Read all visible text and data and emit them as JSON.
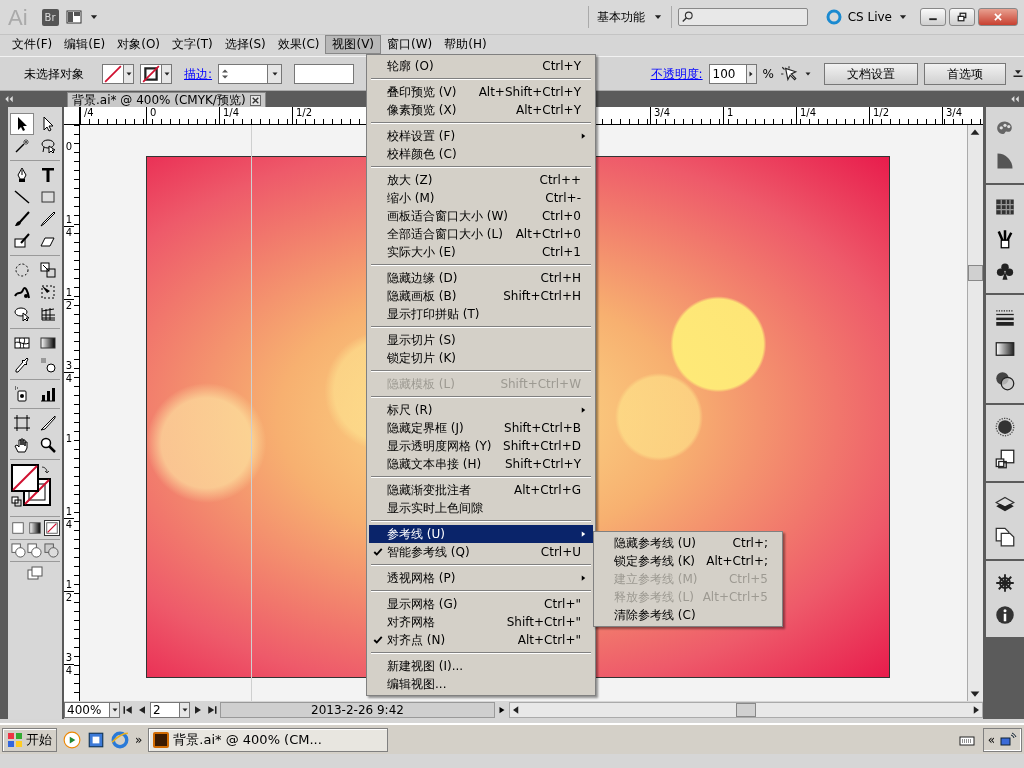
{
  "app_bar": {
    "logo": "Ai",
    "bridge": "Br",
    "workspace": "基本功能",
    "cs_live": "CS Live"
  },
  "menu_bar": [
    {
      "label": "文件(F)",
      "selected": false
    },
    {
      "label": "编辑(E)",
      "selected": false
    },
    {
      "label": "对象(O)",
      "selected": false
    },
    {
      "label": "文字(T)",
      "selected": false
    },
    {
      "label": "选择(S)",
      "selected": false
    },
    {
      "label": "效果(C)",
      "selected": false
    },
    {
      "label": "视图(V)",
      "selected": true
    },
    {
      "label": "窗口(W)",
      "selected": false
    },
    {
      "label": "帮助(H)",
      "selected": false
    }
  ],
  "control_bar": {
    "selection": "未选择对象",
    "stroke_label": "描边:",
    "opacity_label": "不透明度:",
    "opacity": "100",
    "percent": "%",
    "buttons": [
      "文档设置",
      "首选项"
    ]
  },
  "document_tab": {
    "title": "背景.ai* @ 400% (CMYK/预览)"
  },
  "ruler_top": {
    "left_labels": [
      "/4",
      "0",
      "1/4",
      "1/2"
    ],
    "right_labels": [
      "3/4",
      "1",
      "1/4",
      "1/2",
      "3/4"
    ]
  },
  "ruler_left": [
    {
      "num": "0"
    },
    {
      "num": "1",
      "den": "4"
    },
    {
      "num": "1",
      "den": "2"
    },
    {
      "num": "3",
      "den": "4"
    },
    {
      "num": "1"
    },
    {
      "num": "1",
      "den": "4"
    },
    {
      "num": "1",
      "den": "2"
    },
    {
      "num": "3",
      "den": "4"
    }
  ],
  "tools": [
    {
      "selected": true
    },
    {
      "selected": false
    },
    {
      "selected": false
    },
    {
      "selected": false
    },
    {
      "selected": false
    },
    {
      "selected": false
    },
    {
      "selected": false
    },
    {
      "selected": false
    },
    {
      "selected": false
    },
    {
      "selected": false
    },
    {
      "selected": false
    },
    {
      "selected": false
    },
    {
      "selected": false
    },
    {
      "selected": false
    },
    {
      "selected": false
    },
    {
      "selected": false
    },
    {
      "selected": false
    },
    {
      "selected": false
    },
    {
      "selected": false
    },
    {
      "selected": false
    },
    {
      "selected": false
    },
    {
      "selected": false
    },
    {
      "selected": false
    },
    {
      "selected": false
    },
    {
      "selected": false
    },
    {
      "selected": false
    },
    {
      "selected": false
    },
    {
      "selected": false
    }
  ],
  "color_modes": [
    {
      "selected": false
    },
    {
      "selected": false
    },
    {
      "selected": true
    }
  ],
  "view_menu": [
    [
      {
        "label": "轮廓 (O)",
        "shortcut": "Ctrl+Y",
        "submenu": false,
        "checked": false,
        "disabled": false,
        "selected": false
      }
    ],
    [
      {
        "label": "叠印预览 (V)",
        "shortcut": "Alt+Shift+Ctrl+Y",
        "submenu": false,
        "checked": false,
        "disabled": false,
        "selected": false
      },
      {
        "label": "像素预览 (X)",
        "shortcut": "Alt+Ctrl+Y",
        "submenu": false,
        "checked": false,
        "disabled": false,
        "selected": false
      }
    ],
    [
      {
        "label": "校样设置 (F)",
        "submenu": true,
        "checked": false,
        "disabled": false,
        "selected": false
      },
      {
        "label": "校样颜色 (C)",
        "submenu": false,
        "checked": false,
        "disabled": false,
        "selected": false
      }
    ],
    [
      {
        "label": "放大 (Z)",
        "shortcut": "Ctrl++",
        "submenu": false,
        "checked": false,
        "disabled": false,
        "selected": false
      },
      {
        "label": "缩小 (M)",
        "shortcut": "Ctrl+-",
        "submenu": false,
        "checked": false,
        "disabled": false,
        "selected": false
      },
      {
        "label": "画板适合窗口大小 (W)",
        "shortcut": "Ctrl+0",
        "submenu": false,
        "checked": false,
        "disabled": false,
        "selected": false
      },
      {
        "label": "全部适合窗口大小 (L)",
        "shortcut": "Alt+Ctrl+0",
        "submenu": false,
        "checked": false,
        "disabled": false,
        "selected": false
      },
      {
        "label": "实际大小 (E)",
        "shortcut": "Ctrl+1",
        "submenu": false,
        "checked": false,
        "disabled": false,
        "selected": false
      }
    ],
    [
      {
        "label": "隐藏边缘 (D)",
        "shortcut": "Ctrl+H",
        "submenu": false,
        "checked": false,
        "disabled": false,
        "selected": false
      },
      {
        "label": "隐藏画板 (B)",
        "shortcut": "Shift+Ctrl+H",
        "submenu": false,
        "checked": false,
        "disabled": false,
        "selected": false
      },
      {
        "label": "显示打印拼贴 (T)",
        "submenu": false,
        "checked": false,
        "disabled": false,
        "selected": false
      }
    ],
    [
      {
        "label": "显示切片 (S)",
        "submenu": false,
        "checked": false,
        "disabled": false,
        "selected": false
      },
      {
        "label": "锁定切片 (K)",
        "submenu": false,
        "checked": false,
        "disabled": false,
        "selected": false
      }
    ],
    [
      {
        "label": "隐藏模板 (L)",
        "shortcut": "Shift+Ctrl+W",
        "submenu": false,
        "checked": false,
        "disabled": true,
        "selected": false
      }
    ],
    [
      {
        "label": "标尺 (R)",
        "submenu": true,
        "checked": false,
        "disabled": false,
        "selected": false
      },
      {
        "label": "隐藏定界框 (J)",
        "shortcut": "Shift+Ctrl+B",
        "submenu": false,
        "checked": false,
        "disabled": false,
        "selected": false
      },
      {
        "label": "显示透明度网格 (Y)",
        "shortcut": "Shift+Ctrl+D",
        "submenu": false,
        "checked": false,
        "disabled": false,
        "selected": false
      },
      {
        "label": "隐藏文本串接 (H)",
        "shortcut": "Shift+Ctrl+Y",
        "submenu": false,
        "checked": false,
        "disabled": false,
        "selected": false
      }
    ],
    [
      {
        "label": "隐藏渐变批注者",
        "shortcut": "Alt+Ctrl+G",
        "submenu": false,
        "checked": false,
        "disabled": false,
        "selected": false
      },
      {
        "label": "显示实时上色间隙",
        "submenu": false,
        "checked": false,
        "disabled": false,
        "selected": false
      }
    ],
    [
      {
        "label": "参考线 (U)",
        "submenu": true,
        "checked": false,
        "disabled": false,
        "selected": true
      },
      {
        "label": "智能参考线 (Q)",
        "shortcut": "Ctrl+U",
        "submenu": false,
        "checked": true,
        "disabled": false,
        "selected": false
      }
    ],
    [
      {
        "label": "透视网格 (P)",
        "submenu": true,
        "checked": false,
        "disabled": false,
        "selected": false
      }
    ],
    [
      {
        "label": "显示网格 (G)",
        "shortcut": "Ctrl+\"",
        "submenu": false,
        "checked": false,
        "disabled": false,
        "selected": false
      },
      {
        "label": "对齐网格",
        "shortcut": "Shift+Ctrl+\"",
        "submenu": false,
        "checked": false,
        "disabled": false,
        "selected": false
      },
      {
        "label": "对齐点 (N)",
        "shortcut": "Alt+Ctrl+\"",
        "submenu": false,
        "checked": true,
        "disabled": false,
        "selected": false
      }
    ],
    [
      {
        "label": "新建视图 (I)...",
        "submenu": false,
        "checked": false,
        "disabled": false,
        "selected": false
      },
      {
        "label": "编辑视图...",
        "submenu": false,
        "checked": false,
        "disabled": false,
        "selected": false
      }
    ]
  ],
  "guides_submenu": [
    {
      "label": "隐藏参考线 (U)",
      "shortcut": "Ctrl+;",
      "disabled": false
    },
    {
      "label": "锁定参考线 (K)",
      "shortcut": "Alt+Ctrl+;",
      "disabled": false
    },
    {
      "label": "建立参考线 (M)",
      "shortcut": "Ctrl+5",
      "disabled": true
    },
    {
      "label": "释放参考线 (L)",
      "shortcut": "Alt+Ctrl+5",
      "disabled": true
    },
    {
      "label": "清除参考线 (C)",
      "disabled": false
    }
  ],
  "status_bar": {
    "zoom": "400%",
    "artboard": "2",
    "status": "2013-2-26  9:42"
  },
  "taskbar": {
    "start": "开始",
    "more": "»",
    "task": "背景.ai* @ 400% (CM...",
    "tray_toggle": "«"
  }
}
